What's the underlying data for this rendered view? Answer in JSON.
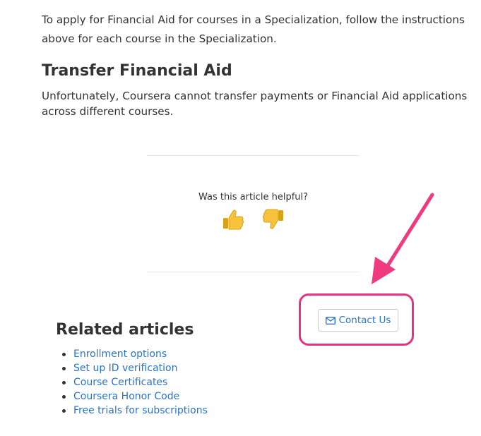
{
  "intro": {
    "text": "To apply for Financial Aid for courses in a Specialization, follow the instructions above for each course in the Specialization."
  },
  "transfer": {
    "heading": "Transfer Financial Aid",
    "body": "Unfortunately, Coursera cannot transfer payments or Financial Aid applications across different courses."
  },
  "feedback": {
    "question": "Was this article helpful?",
    "thumbs_up_icon": "thumbs-up-emoji",
    "thumbs_down_icon": "thumbs-down-emoji"
  },
  "contact": {
    "label": "Contact Us",
    "icon": "envelope-icon",
    "highlight_color": "#e8317f"
  },
  "related": {
    "title": "Related articles",
    "items": [
      "Enrollment options",
      "Set up ID verification",
      "Course Certificates",
      "Coursera Honor Code",
      "Free trials for subscriptions"
    ]
  },
  "colors": {
    "link": "#2a73cc",
    "annotation_arrow": "#f0397f",
    "text": "#333333"
  }
}
